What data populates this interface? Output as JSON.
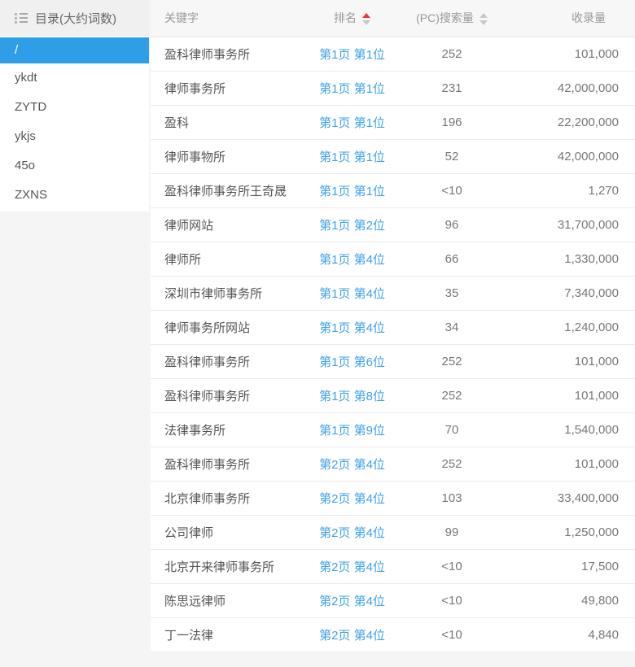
{
  "colors": {
    "accent_blue": "#2f9ee9",
    "link_blue": "#3da2ea",
    "sort_active_red": "#e4393c",
    "sort_inactive_gray": "#c8c8c8"
  },
  "sidebar": {
    "header": {
      "icon": "list-icon",
      "title": "目录(大约词数)"
    },
    "items": [
      {
        "label": "/",
        "selected": true
      },
      {
        "label": "ykdt",
        "selected": false
      },
      {
        "label": "ZYTD",
        "selected": false
      },
      {
        "label": "ykjs",
        "selected": false
      },
      {
        "label": "45o",
        "selected": false
      },
      {
        "label": "ZXNS",
        "selected": false
      }
    ]
  },
  "table": {
    "columns": [
      {
        "label": "关键字",
        "sortable": false,
        "sort": "none"
      },
      {
        "label": "排名",
        "sortable": true,
        "sort": "asc"
      },
      {
        "label": "(PC)搜索量",
        "sortable": true,
        "sort": "none"
      },
      {
        "label": "收录量",
        "sortable": false,
        "sort": "none"
      }
    ],
    "rows": [
      {
        "keyword": "盈科律师事务所",
        "rank": "第1页 第1位",
        "search_volume": "252",
        "indexed": "101,000"
      },
      {
        "keyword": "律师事务所",
        "rank": "第1页 第1位",
        "search_volume": "231",
        "indexed": "42,000,000"
      },
      {
        "keyword": "盈科",
        "rank": "第1页 第1位",
        "search_volume": "196",
        "indexed": "22,200,000"
      },
      {
        "keyword": "律师事物所",
        "rank": "第1页 第1位",
        "search_volume": "52",
        "indexed": "42,000,000"
      },
      {
        "keyword": "盈科律师事务所王奇晟",
        "rank": "第1页 第1位",
        "search_volume": "<10",
        "indexed": "1,270"
      },
      {
        "keyword": "律师网站",
        "rank": "第1页 第2位",
        "search_volume": "96",
        "indexed": "31,700,000"
      },
      {
        "keyword": "律师所",
        "rank": "第1页 第4位",
        "search_volume": "66",
        "indexed": "1,330,000"
      },
      {
        "keyword": "深圳市律师事务所",
        "rank": "第1页 第4位",
        "search_volume": "35",
        "indexed": "7,340,000"
      },
      {
        "keyword": "律师事务所网站",
        "rank": "第1页 第4位",
        "search_volume": "34",
        "indexed": "1,240,000"
      },
      {
        "keyword": "盈科律师事务所",
        "rank": "第1页 第6位",
        "search_volume": "252",
        "indexed": "101,000"
      },
      {
        "keyword": "盈科律师事务所",
        "rank": "第1页 第8位",
        "search_volume": "252",
        "indexed": "101,000"
      },
      {
        "keyword": "法律事务所",
        "rank": "第1页 第9位",
        "search_volume": "70",
        "indexed": "1,540,000"
      },
      {
        "keyword": "盈科律师事务所",
        "rank": "第2页 第4位",
        "search_volume": "252",
        "indexed": "101,000"
      },
      {
        "keyword": "北京律师事务所",
        "rank": "第2页 第4位",
        "search_volume": "103",
        "indexed": "33,400,000"
      },
      {
        "keyword": "公司律师",
        "rank": "第2页 第4位",
        "search_volume": "99",
        "indexed": "1,250,000"
      },
      {
        "keyword": "北京开来律师事务所",
        "rank": "第2页 第4位",
        "search_volume": "<10",
        "indexed": "17,500"
      },
      {
        "keyword": "陈思远律师",
        "rank": "第2页 第4位",
        "search_volume": "<10",
        "indexed": "49,800"
      },
      {
        "keyword": "丁一法律",
        "rank": "第2页 第4位",
        "search_volume": "<10",
        "indexed": "4,840"
      }
    ]
  }
}
